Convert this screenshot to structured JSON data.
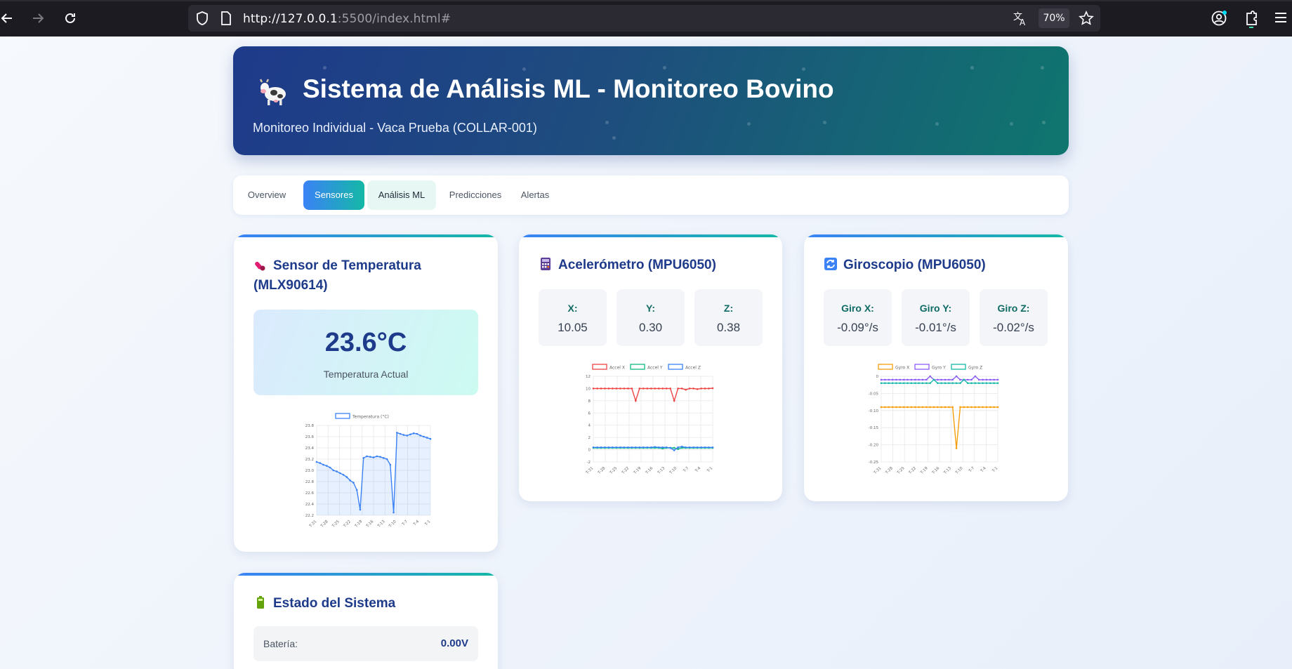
{
  "browser": {
    "url_main": "http://127.0.0.1",
    "url_rest": ":5500/index.html#",
    "zoom": "70%"
  },
  "header": {
    "title": "Sistema de Análisis ML - Monitoreo Bovino",
    "subtitle": "Monitoreo Individual - Vaca Prueba (COLLAR-001)"
  },
  "tabs": [
    {
      "label": "Overview"
    },
    {
      "label": "Sensores"
    },
    {
      "label": "Análisis ML"
    },
    {
      "label": "Predicciones"
    },
    {
      "label": "Alertas"
    }
  ],
  "temperature": {
    "title": "Sensor de Temperatura (MLX90614)",
    "value": "23.6°C",
    "label": "Temperatura Actual"
  },
  "accelerometer": {
    "title": "Acelerómetro (MPU6050)",
    "x_label": "X:",
    "x_value": "10.05",
    "y_label": "Y:",
    "y_value": "0.30",
    "z_label": "Z:",
    "z_value": "0.38"
  },
  "gyroscope": {
    "title": "Giroscopio (MPU6050)",
    "x_label": "Giro X:",
    "x_value": "-0.09°/s",
    "y_label": "Giro Y:",
    "y_value": "-0.01°/s",
    "z_label": "Giro Z:",
    "z_value": "-0.02°/s"
  },
  "system": {
    "title": "Estado del Sistema",
    "battery_label": "Batería:",
    "battery_value": "0.00V"
  },
  "chart_data": [
    {
      "type": "line",
      "title": "",
      "x": [
        "T-31",
        "T-28",
        "T-25",
        "T-22",
        "T-19",
        "T-16",
        "T-13",
        "T-10",
        "T-7",
        "T-4",
        "T-1"
      ],
      "ylim": [
        22.2,
        23.8
      ],
      "yticks": [
        "23.8",
        "23.6",
        "23.4",
        "23.2",
        "23.0",
        "22.8",
        "22.6",
        "22.4",
        "22.2"
      ],
      "series": [
        {
          "name": "Temperatura (°C)",
          "color": "#3b82f6",
          "values": [
            23.15,
            23.13,
            23.1,
            23.08,
            23.05,
            23.0,
            22.98,
            22.95,
            22.92,
            22.88,
            22.82,
            22.78,
            22.65,
            22.3,
            23.22,
            23.25,
            23.24,
            23.23,
            23.25,
            23.24,
            23.22,
            23.2,
            23.1,
            22.25,
            23.67,
            23.65,
            23.63,
            23.62,
            23.64,
            23.66,
            23.65,
            23.62,
            23.6,
            23.58,
            23.56
          ]
        }
      ],
      "fill": true,
      "grid": true,
      "legend": "top"
    },
    {
      "type": "line",
      "title": "",
      "x": [
        "T-31",
        "T-28",
        "T-25",
        "T-22",
        "T-19",
        "T-16",
        "T-13",
        "T-10",
        "T-7",
        "T-4",
        "T-1"
      ],
      "ylim": [
        -2,
        12
      ],
      "yticks": [
        "12",
        "10",
        "8",
        "6",
        "4",
        "2",
        "0",
        "-2"
      ],
      "series": [
        {
          "name": "Accel X",
          "color": "#ef4444",
          "values": [
            10,
            10,
            10,
            10,
            10,
            10,
            10,
            10,
            10,
            10,
            10,
            8,
            10,
            10,
            10,
            10,
            10,
            10,
            10,
            10,
            10,
            8,
            10,
            10,
            9.8,
            10,
            10,
            9.9,
            10,
            10,
            10,
            10.05
          ]
        },
        {
          "name": "Accel Y",
          "color": "#10b981",
          "values": [
            0.3,
            0.3,
            0.3,
            0.3,
            0.3,
            0.3,
            0.3,
            0.3,
            0.3,
            0.3,
            0.3,
            0.3,
            0.3,
            0.3,
            0.3,
            0.3,
            0.3,
            0.3,
            0.2,
            0.3,
            0.3,
            0.3,
            0.1,
            0.3,
            0.3,
            0.3,
            0.3,
            0.3,
            0.3,
            0.3,
            0.3,
            0.3
          ]
        },
        {
          "name": "Accel Z",
          "color": "#3b82f6",
          "values": [
            0.38,
            0.38,
            0.38,
            0.38,
            0.38,
            0.38,
            0.38,
            0.38,
            0.38,
            0.38,
            0.38,
            0.38,
            0.38,
            0.38,
            0.38,
            0.38,
            0.45,
            0.38,
            0.38,
            0.38,
            0.3,
            -0.1,
            0.38,
            0.5,
            0.38,
            0.38,
            0.38,
            0.38,
            0.38,
            0.38,
            0.38,
            0.38
          ]
        }
      ],
      "grid": true,
      "legend": "top"
    },
    {
      "type": "line",
      "title": "",
      "x": [
        "T-31",
        "T-28",
        "T-25",
        "T-22",
        "T-19",
        "T-16",
        "T-13",
        "T-10",
        "T-7",
        "T-4",
        "T-1"
      ],
      "ylim": [
        -0.25,
        0.0
      ],
      "yticks": [
        "0",
        "-0.05",
        "-0.10",
        "-0.15",
        "-0.20",
        "-0.25"
      ],
      "series": [
        {
          "name": "Gyro X",
          "color": "#f59e0b",
          "values": [
            -0.09,
            -0.09,
            -0.09,
            -0.09,
            -0.09,
            -0.09,
            -0.09,
            -0.09,
            -0.09,
            -0.09,
            -0.09,
            -0.09,
            -0.09,
            -0.09,
            -0.09,
            -0.09,
            -0.09,
            -0.09,
            -0.09,
            -0.09,
            -0.21,
            -0.09,
            -0.09,
            -0.09,
            -0.09,
            -0.09,
            -0.09,
            -0.09,
            -0.09,
            -0.09,
            -0.09,
            -0.09
          ]
        },
        {
          "name": "Gyro Y",
          "color": "#8b5cf6",
          "values": [
            -0.01,
            -0.01,
            -0.01,
            -0.01,
            -0.01,
            -0.01,
            -0.01,
            -0.01,
            -0.01,
            -0.01,
            -0.01,
            -0.01,
            -0.01,
            0.0,
            -0.01,
            -0.01,
            -0.01,
            -0.01,
            -0.01,
            -0.01,
            0.0,
            -0.01,
            -0.01,
            -0.01,
            -0.01,
            0.0,
            -0.01,
            -0.01,
            -0.01,
            -0.01,
            -0.01,
            -0.01
          ]
        },
        {
          "name": "Gyro Z",
          "color": "#14b8a6",
          "values": [
            -0.02,
            -0.02,
            -0.02,
            -0.02,
            -0.02,
            -0.02,
            -0.02,
            -0.02,
            -0.02,
            -0.02,
            -0.02,
            -0.02,
            -0.02,
            -0.02,
            -0.01,
            -0.02,
            -0.02,
            -0.02,
            -0.02,
            -0.02,
            -0.02,
            -0.02,
            -0.01,
            -0.02,
            -0.02,
            -0.02,
            -0.02,
            -0.02,
            -0.02,
            -0.02,
            -0.02,
            -0.02
          ]
        }
      ],
      "grid": true,
      "legend": "top"
    }
  ]
}
